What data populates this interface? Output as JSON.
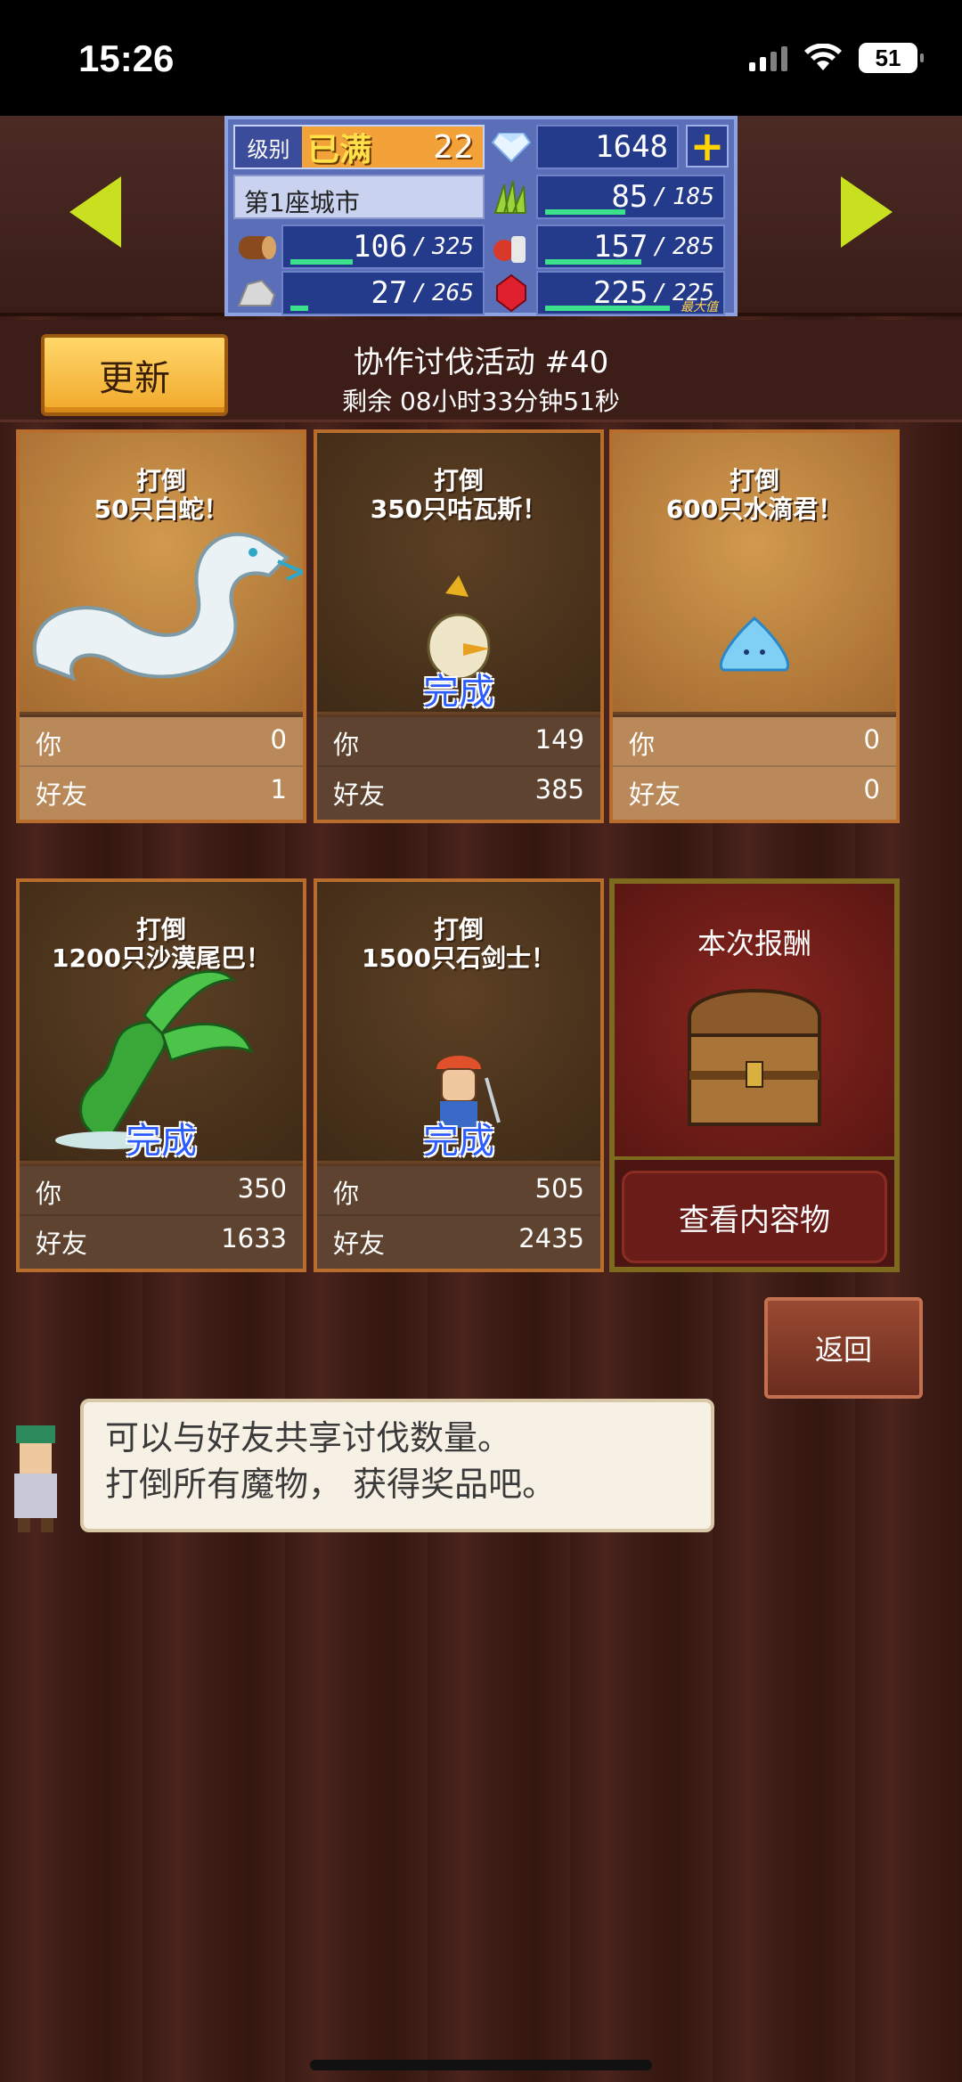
{
  "status": {
    "time": "15:26",
    "battery": "51"
  },
  "resources": {
    "level_label": "级别",
    "level_max": "已满",
    "level": "22",
    "gems": "1648",
    "city": "第1座城市",
    "wood": {
      "cur": "106",
      "cap": "325",
      "fill": 0.33
    },
    "grass": {
      "cur": "85",
      "cap": "185",
      "fill": 0.46
    },
    "food": {
      "cur": "157",
      "cap": "285",
      "fill": 0.55
    },
    "stone": {
      "cur": "27",
      "cap": "265",
      "fill": 0.1
    },
    "ruby": {
      "cur": "225",
      "cap": "225",
      "fill": 1.0,
      "max_tag": "最大值"
    }
  },
  "event": {
    "refresh_label": "更新",
    "title": "协作讨伐活动 #40",
    "remaining": "剩余 08小时33分钟51秒"
  },
  "labels": {
    "you": "你",
    "friends": "好友",
    "done": "完成"
  },
  "cards": [
    {
      "goal_line1": "打倒",
      "goal_line2": "50只白蛇！",
      "you": "0",
      "friends": "1",
      "done": false
    },
    {
      "goal_line1": "打倒",
      "goal_line2": "350只咕瓦斯！",
      "you": "149",
      "friends": "385",
      "done": true
    },
    {
      "goal_line1": "打倒",
      "goal_line2": "600只水滴君！",
      "you": "0",
      "friends": "0",
      "done": false
    },
    {
      "goal_line1": "打倒",
      "goal_line2": "1200只沙漠尾巴！",
      "you": "350",
      "friends": "1633",
      "done": true
    },
    {
      "goal_line1": "打倒",
      "goal_line2": "1500只石剑士！",
      "you": "505",
      "friends": "2435",
      "done": true
    }
  ],
  "reward": {
    "title": "本次报酬",
    "button": "查看内容物"
  },
  "tip": {
    "line1": "可以与好友共享讨伐数量。",
    "line2": "打倒所有魔物， 获得奖品吧。"
  },
  "back_label": "返回"
}
